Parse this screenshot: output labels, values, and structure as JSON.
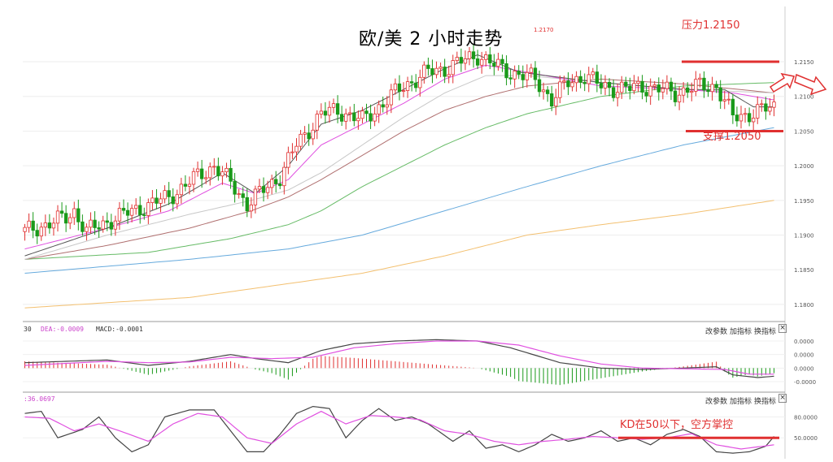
{
  "page": {
    "title": "欧/美 2 小时走势"
  },
  "annotations": {
    "resistance": "压力1.2150",
    "support": "支撑1.2050",
    "kd_note": "KD在50以下，空方掌控",
    "peak_label": "1.2170"
  },
  "macd_panel": {
    "label_prefix": "30",
    "dea_label": "DEA:-0.0009",
    "macd_label": "MACD:-0.0001",
    "controls": [
      "改参数",
      "加指标",
      "换指标"
    ],
    "close_symbol": "×"
  },
  "kd_panel": {
    "label": ":36.0697",
    "controls": [
      "改参数",
      "加指标",
      "换指标"
    ],
    "close_symbol": "×"
  },
  "colors": {
    "up": "#e03030",
    "down": "#1a9a1a",
    "ma_gray": "#555555",
    "ma_magenta": "#e050e0",
    "ma_light": "#c8c8c8",
    "ma_brown": "#b07070",
    "ma_green": "#66bb66",
    "ma_blue": "#66aadd",
    "ma_orange": "#f3c070",
    "red_line": "#e03030"
  },
  "chart_data": [
    {
      "type": "candlestick",
      "title": "欧/美 2 小时走势",
      "ylim": [
        1.178,
        1.2225
      ],
      "y_ticks": [
        1.215,
        1.21,
        1.205,
        1.2,
        1.195,
        1.19,
        1.185,
        1.18
      ],
      "y_tick_labels": [
        "1.2150",
        "1.2100",
        "1.2050",
        "1.2000",
        "1.1950",
        "1.1900",
        "1.1850",
        "1.1800"
      ],
      "grid": true,
      "horizontal_lines": [
        {
          "value": 1.215,
          "label": "压力1.2150"
        },
        {
          "value": 1.205,
          "label": "支撑1.2050"
        }
      ],
      "anchors": {
        "close": [
          [
            0,
            1.1905
          ],
          [
            10,
            1.1925
          ],
          [
            12,
            1.1935
          ],
          [
            15,
            1.1905
          ],
          [
            22,
            1.1925
          ],
          [
            35,
            1.1955
          ],
          [
            42,
            1.1985
          ],
          [
            46,
            1.2
          ],
          [
            50,
            1.1975
          ],
          [
            54,
            1.1945
          ],
          [
            58,
            1.1965
          ],
          [
            62,
            1.1985
          ],
          [
            66,
            1.203
          ],
          [
            72,
            1.2075
          ],
          [
            76,
            1.208
          ],
          [
            82,
            1.2065
          ],
          [
            88,
            1.2095
          ],
          [
            92,
            1.2115
          ],
          [
            98,
            1.2135
          ],
          [
            102,
            1.214
          ],
          [
            110,
            1.216
          ],
          [
            114,
            1.2145
          ],
          [
            118,
            1.2135
          ],
          [
            124,
            1.2125
          ],
          [
            128,
            1.2095
          ],
          [
            132,
            1.212
          ],
          [
            136,
            1.213
          ],
          [
            140,
            1.2115
          ],
          [
            146,
            1.211
          ],
          [
            150,
            1.2115
          ],
          [
            154,
            1.211
          ],
          [
            158,
            1.2105
          ],
          [
            164,
            1.2115
          ],
          [
            168,
            1.2115
          ],
          [
            172,
            1.207
          ],
          [
            176,
            1.2075
          ],
          [
            182,
            1.2085
          ]
        ],
        "ma_gray": [
          [
            0,
            1.187
          ],
          [
            20,
            1.191
          ],
          [
            35,
            1.1945
          ],
          [
            48,
            1.199
          ],
          [
            56,
            1.196
          ],
          [
            64,
            1.2
          ],
          [
            72,
            1.206
          ],
          [
            82,
            1.208
          ],
          [
            92,
            1.211
          ],
          [
            102,
            1.214
          ],
          [
            110,
            1.216
          ],
          [
            120,
            1.2135
          ],
          [
            140,
            1.212
          ],
          [
            160,
            1.211
          ],
          [
            170,
            1.211
          ],
          [
            177,
            1.2085
          ],
          [
            182,
            1.2085
          ]
        ],
        "ma_magenta": [
          [
            0,
            1.188
          ],
          [
            20,
            1.191
          ],
          [
            35,
            1.1935
          ],
          [
            48,
            1.1975
          ],
          [
            56,
            1.196
          ],
          [
            64,
            1.198
          ],
          [
            72,
            1.203
          ],
          [
            82,
            1.206
          ],
          [
            92,
            1.209
          ],
          [
            102,
            1.2125
          ],
          [
            112,
            1.2145
          ],
          [
            122,
            1.2135
          ],
          [
            140,
            1.2115
          ],
          [
            160,
            1.211
          ],
          [
            172,
            1.2105
          ],
          [
            182,
            1.2095
          ]
        ],
        "ma_light": [
          [
            0,
            1.1865
          ],
          [
            20,
            1.19
          ],
          [
            40,
            1.193
          ],
          [
            55,
            1.195
          ],
          [
            64,
            1.1965
          ],
          [
            72,
            1.199
          ],
          [
            82,
            1.203
          ],
          [
            92,
            1.207
          ],
          [
            102,
            1.2105
          ],
          [
            112,
            1.213
          ],
          [
            122,
            1.213
          ],
          [
            140,
            1.212
          ],
          [
            160,
            1.211
          ],
          [
            182,
            1.2105
          ]
        ],
        "ma_brown": [
          [
            0,
            1.1865
          ],
          [
            20,
            1.1885
          ],
          [
            40,
            1.191
          ],
          [
            55,
            1.1935
          ],
          [
            64,
            1.1955
          ],
          [
            72,
            1.198
          ],
          [
            82,
            1.2015
          ],
          [
            92,
            1.205
          ],
          [
            102,
            1.208
          ],
          [
            112,
            1.21
          ],
          [
            122,
            1.2115
          ],
          [
            140,
            1.2125
          ],
          [
            160,
            1.2118
          ],
          [
            182,
            1.2105
          ]
        ],
        "ma_green": [
          [
            0,
            1.1865
          ],
          [
            30,
            1.1875
          ],
          [
            50,
            1.1895
          ],
          [
            64,
            1.1915
          ],
          [
            72,
            1.1935
          ],
          [
            82,
            1.197
          ],
          [
            92,
            1.2
          ],
          [
            102,
            1.203
          ],
          [
            112,
            1.2055
          ],
          [
            122,
            1.2075
          ],
          [
            140,
            1.21
          ],
          [
            160,
            1.2115
          ],
          [
            182,
            1.212
          ]
        ],
        "ma_blue": [
          [
            0,
            1.1845
          ],
          [
            40,
            1.1865
          ],
          [
            64,
            1.188
          ],
          [
            82,
            1.19
          ],
          [
            102,
            1.1935
          ],
          [
            122,
            1.197
          ],
          [
            140,
            1.2
          ],
          [
            160,
            1.203
          ],
          [
            182,
            1.2055
          ]
        ],
        "ma_orange": [
          [
            0,
            1.1795
          ],
          [
            40,
            1.181
          ],
          [
            64,
            1.183
          ],
          [
            82,
            1.1845
          ],
          [
            102,
            1.187
          ],
          [
            122,
            1.19
          ],
          [
            140,
            1.1915
          ],
          [
            160,
            1.193
          ],
          [
            182,
            1.195
          ]
        ]
      }
    },
    {
      "type": "macd",
      "y_ticks": [
        0.004,
        0.002,
        0.0,
        -0.002
      ],
      "y_tick_labels": [
        "0.0000",
        "0.0000",
        "0.0000",
        "-0.0000"
      ],
      "ylim": [
        -0.0032,
        0.0052
      ],
      "dif": [
        [
          0,
          0.0008
        ],
        [
          20,
          0.0012
        ],
        [
          30,
          0.0004
        ],
        [
          40,
          0.001
        ],
        [
          50,
          0.002
        ],
        [
          56,
          0.0014
        ],
        [
          64,
          0.0008
        ],
        [
          72,
          0.0026
        ],
        [
          80,
          0.0036
        ],
        [
          90,
          0.004
        ],
        [
          100,
          0.0042
        ],
        [
          110,
          0.004
        ],
        [
          118,
          0.003
        ],
        [
          130,
          0.0008
        ],
        [
          140,
          0.0
        ],
        [
          150,
          -0.0002
        ],
        [
          160,
          0.0
        ],
        [
          168,
          0.0002
        ],
        [
          172,
          -0.001
        ],
        [
          178,
          -0.0014
        ],
        [
          182,
          -0.0012
        ]
      ],
      "dea": [
        [
          0,
          0.0004
        ],
        [
          20,
          0.001
        ],
        [
          30,
          0.0008
        ],
        [
          40,
          0.0009
        ],
        [
          50,
          0.0016
        ],
        [
          60,
          0.0014
        ],
        [
          70,
          0.0016
        ],
        [
          80,
          0.003
        ],
        [
          90,
          0.0036
        ],
        [
          100,
          0.004
        ],
        [
          110,
          0.004
        ],
        [
          120,
          0.0034
        ],
        [
          130,
          0.0018
        ],
        [
          140,
          0.0006
        ],
        [
          150,
          0.0
        ],
        [
          160,
          -0.0001
        ],
        [
          170,
          -0.0002
        ],
        [
          176,
          -0.0009
        ],
        [
          182,
          -0.0009
        ]
      ]
    },
    {
      "type": "kd",
      "y_ticks": [
        80,
        50
      ],
      "y_tick_labels": [
        "80.0000",
        "50.0000"
      ],
      "ylim": [
        20,
        105
      ],
      "horizontal_lines": [
        {
          "value": 50,
          "label": "KD在50以下，空方掌控"
        }
      ],
      "k": [
        [
          0,
          85
        ],
        [
          4,
          88
        ],
        [
          8,
          50
        ],
        [
          14,
          62
        ],
        [
          18,
          80
        ],
        [
          22,
          50
        ],
        [
          26,
          30
        ],
        [
          30,
          40
        ],
        [
          34,
          80
        ],
        [
          40,
          90
        ],
        [
          46,
          90
        ],
        [
          50,
          60
        ],
        [
          54,
          30
        ],
        [
          58,
          30
        ],
        [
          62,
          55
        ],
        [
          66,
          85
        ],
        [
          70,
          95
        ],
        [
          74,
          92
        ],
        [
          78,
          50
        ],
        [
          82,
          75
        ],
        [
          86,
          92
        ],
        [
          90,
          75
        ],
        [
          94,
          80
        ],
        [
          98,
          70
        ],
        [
          104,
          45
        ],
        [
          108,
          60
        ],
        [
          112,
          35
        ],
        [
          116,
          40
        ],
        [
          120,
          30
        ],
        [
          124,
          40
        ],
        [
          128,
          55
        ],
        [
          132,
          45
        ],
        [
          136,
          50
        ],
        [
          140,
          60
        ],
        [
          144,
          45
        ],
        [
          148,
          50
        ],
        [
          152,
          40
        ],
        [
          156,
          55
        ],
        [
          160,
          62
        ],
        [
          164,
          52
        ],
        [
          168,
          30
        ],
        [
          172,
          28
        ],
        [
          176,
          30
        ],
        [
          180,
          38
        ],
        [
          182,
          52
        ]
      ],
      "d": [
        [
          0,
          80
        ],
        [
          6,
          78
        ],
        [
          12,
          60
        ],
        [
          18,
          70
        ],
        [
          24,
          58
        ],
        [
          30,
          45
        ],
        [
          36,
          70
        ],
        [
          42,
          85
        ],
        [
          48,
          80
        ],
        [
          54,
          50
        ],
        [
          60,
          42
        ],
        [
          66,
          70
        ],
        [
          72,
          88
        ],
        [
          78,
          70
        ],
        [
          84,
          82
        ],
        [
          90,
          80
        ],
        [
          96,
          76
        ],
        [
          102,
          60
        ],
        [
          108,
          55
        ],
        [
          114,
          45
        ],
        [
          120,
          40
        ],
        [
          126,
          45
        ],
        [
          132,
          48
        ],
        [
          138,
          52
        ],
        [
          144,
          50
        ],
        [
          150,
          48
        ],
        [
          156,
          50
        ],
        [
          162,
          56
        ],
        [
          168,
          40
        ],
        [
          174,
          34
        ],
        [
          182,
          40
        ]
      ]
    }
  ]
}
